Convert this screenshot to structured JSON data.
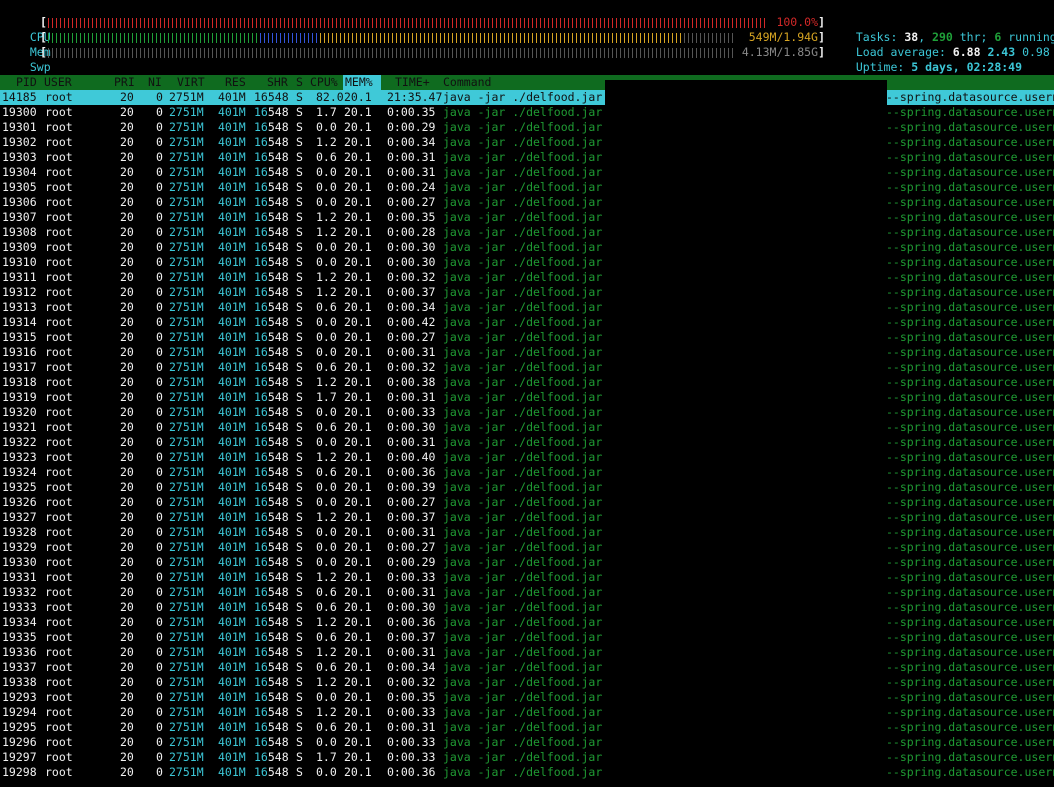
{
  "meters": {
    "cpu": {
      "label": "CPU",
      "value": "100.0%",
      "fraction": 1.0,
      "color": "#d22828"
    },
    "mem": {
      "label": "Mem",
      "value": "549M/1.94G",
      "fraction": 0.93,
      "segments": [
        {
          "fraction": 0.31,
          "color": "#1fa039"
        },
        {
          "fraction": 0.09,
          "color": "#3355dd"
        },
        {
          "fraction": 0.53,
          "color": "#d6a422"
        }
      ]
    },
    "swp": {
      "label": "Swp",
      "value": "4.13M/1.85G",
      "fraction": 0.002,
      "color": "#d22828"
    }
  },
  "stats": {
    "tasks_label": "Tasks: ",
    "tasks": "38",
    "thr_sep": ", ",
    "thr": "290",
    "thr_label": " thr; ",
    "running": "6",
    "running_label": " running",
    "load_label": "Load average: ",
    "load1": "6.88",
    "load5": "2.43",
    "load15": "0.98",
    "uptime_label": "Uptime: ",
    "uptime": "5 days, 02:28:49"
  },
  "columns": [
    "PID",
    "USER",
    "PRI",
    "NI",
    "VIRT",
    "RES",
    "SHR",
    "S",
    "CPU%",
    "MEM%",
    "TIME+",
    "Command"
  ],
  "sort_column": "MEM%",
  "command_prefix": "java -jar ./delfood.jar",
  "command_suffix": "--spring.datasource.usern",
  "rows": [
    {
      "pid": "14185",
      "user": "root",
      "pri": "20",
      "ni": "0",
      "virt": "2751M",
      "res": "401M",
      "shr": "16548",
      "s": "S",
      "cpu": "82.0",
      "mem": "20.1",
      "time": "21:35.47",
      "selected": true
    },
    {
      "pid": "19300",
      "user": "root",
      "pri": "20",
      "ni": "0",
      "virt": "2751M",
      "res": "401M",
      "shr": "16548",
      "s": "S",
      "cpu": "1.7",
      "mem": "20.1",
      "time": "0:00.35"
    },
    {
      "pid": "19301",
      "user": "root",
      "pri": "20",
      "ni": "0",
      "virt": "2751M",
      "res": "401M",
      "shr": "16548",
      "s": "S",
      "cpu": "0.0",
      "mem": "20.1",
      "time": "0:00.29"
    },
    {
      "pid": "19302",
      "user": "root",
      "pri": "20",
      "ni": "0",
      "virt": "2751M",
      "res": "401M",
      "shr": "16548",
      "s": "S",
      "cpu": "1.2",
      "mem": "20.1",
      "time": "0:00.34"
    },
    {
      "pid": "19303",
      "user": "root",
      "pri": "20",
      "ni": "0",
      "virt": "2751M",
      "res": "401M",
      "shr": "16548",
      "s": "S",
      "cpu": "0.6",
      "mem": "20.1",
      "time": "0:00.31"
    },
    {
      "pid": "19304",
      "user": "root",
      "pri": "20",
      "ni": "0",
      "virt": "2751M",
      "res": "401M",
      "shr": "16548",
      "s": "S",
      "cpu": "0.0",
      "mem": "20.1",
      "time": "0:00.31"
    },
    {
      "pid": "19305",
      "user": "root",
      "pri": "20",
      "ni": "0",
      "virt": "2751M",
      "res": "401M",
      "shr": "16548",
      "s": "S",
      "cpu": "0.0",
      "mem": "20.1",
      "time": "0:00.24"
    },
    {
      "pid": "19306",
      "user": "root",
      "pri": "20",
      "ni": "0",
      "virt": "2751M",
      "res": "401M",
      "shr": "16548",
      "s": "S",
      "cpu": "0.0",
      "mem": "20.1",
      "time": "0:00.27"
    },
    {
      "pid": "19307",
      "user": "root",
      "pri": "20",
      "ni": "0",
      "virt": "2751M",
      "res": "401M",
      "shr": "16548",
      "s": "S",
      "cpu": "1.2",
      "mem": "20.1",
      "time": "0:00.35"
    },
    {
      "pid": "19308",
      "user": "root",
      "pri": "20",
      "ni": "0",
      "virt": "2751M",
      "res": "401M",
      "shr": "16548",
      "s": "S",
      "cpu": "1.2",
      "mem": "20.1",
      "time": "0:00.28"
    },
    {
      "pid": "19309",
      "user": "root",
      "pri": "20",
      "ni": "0",
      "virt": "2751M",
      "res": "401M",
      "shr": "16548",
      "s": "S",
      "cpu": "0.0",
      "mem": "20.1",
      "time": "0:00.30"
    },
    {
      "pid": "19310",
      "user": "root",
      "pri": "20",
      "ni": "0",
      "virt": "2751M",
      "res": "401M",
      "shr": "16548",
      "s": "S",
      "cpu": "0.0",
      "mem": "20.1",
      "time": "0:00.30"
    },
    {
      "pid": "19311",
      "user": "root",
      "pri": "20",
      "ni": "0",
      "virt": "2751M",
      "res": "401M",
      "shr": "16548",
      "s": "S",
      "cpu": "1.2",
      "mem": "20.1",
      "time": "0:00.32"
    },
    {
      "pid": "19312",
      "user": "root",
      "pri": "20",
      "ni": "0",
      "virt": "2751M",
      "res": "401M",
      "shr": "16548",
      "s": "S",
      "cpu": "1.2",
      "mem": "20.1",
      "time": "0:00.37"
    },
    {
      "pid": "19313",
      "user": "root",
      "pri": "20",
      "ni": "0",
      "virt": "2751M",
      "res": "401M",
      "shr": "16548",
      "s": "S",
      "cpu": "0.6",
      "mem": "20.1",
      "time": "0:00.34"
    },
    {
      "pid": "19314",
      "user": "root",
      "pri": "20",
      "ni": "0",
      "virt": "2751M",
      "res": "401M",
      "shr": "16548",
      "s": "S",
      "cpu": "0.0",
      "mem": "20.1",
      "time": "0:00.42"
    },
    {
      "pid": "19315",
      "user": "root",
      "pri": "20",
      "ni": "0",
      "virt": "2751M",
      "res": "401M",
      "shr": "16548",
      "s": "S",
      "cpu": "0.0",
      "mem": "20.1",
      "time": "0:00.27"
    },
    {
      "pid": "19316",
      "user": "root",
      "pri": "20",
      "ni": "0",
      "virt": "2751M",
      "res": "401M",
      "shr": "16548",
      "s": "S",
      "cpu": "0.0",
      "mem": "20.1",
      "time": "0:00.31"
    },
    {
      "pid": "19317",
      "user": "root",
      "pri": "20",
      "ni": "0",
      "virt": "2751M",
      "res": "401M",
      "shr": "16548",
      "s": "S",
      "cpu": "0.6",
      "mem": "20.1",
      "time": "0:00.32"
    },
    {
      "pid": "19318",
      "user": "root",
      "pri": "20",
      "ni": "0",
      "virt": "2751M",
      "res": "401M",
      "shr": "16548",
      "s": "S",
      "cpu": "1.2",
      "mem": "20.1",
      "time": "0:00.38"
    },
    {
      "pid": "19319",
      "user": "root",
      "pri": "20",
      "ni": "0",
      "virt": "2751M",
      "res": "401M",
      "shr": "16548",
      "s": "S",
      "cpu": "1.7",
      "mem": "20.1",
      "time": "0:00.31"
    },
    {
      "pid": "19320",
      "user": "root",
      "pri": "20",
      "ni": "0",
      "virt": "2751M",
      "res": "401M",
      "shr": "16548",
      "s": "S",
      "cpu": "0.0",
      "mem": "20.1",
      "time": "0:00.33"
    },
    {
      "pid": "19321",
      "user": "root",
      "pri": "20",
      "ni": "0",
      "virt": "2751M",
      "res": "401M",
      "shr": "16548",
      "s": "S",
      "cpu": "0.6",
      "mem": "20.1",
      "time": "0:00.30"
    },
    {
      "pid": "19322",
      "user": "root",
      "pri": "20",
      "ni": "0",
      "virt": "2751M",
      "res": "401M",
      "shr": "16548",
      "s": "S",
      "cpu": "0.0",
      "mem": "20.1",
      "time": "0:00.31"
    },
    {
      "pid": "19323",
      "user": "root",
      "pri": "20",
      "ni": "0",
      "virt": "2751M",
      "res": "401M",
      "shr": "16548",
      "s": "S",
      "cpu": "1.2",
      "mem": "20.1",
      "time": "0:00.40"
    },
    {
      "pid": "19324",
      "user": "root",
      "pri": "20",
      "ni": "0",
      "virt": "2751M",
      "res": "401M",
      "shr": "16548",
      "s": "S",
      "cpu": "0.6",
      "mem": "20.1",
      "time": "0:00.36"
    },
    {
      "pid": "19325",
      "user": "root",
      "pri": "20",
      "ni": "0",
      "virt": "2751M",
      "res": "401M",
      "shr": "16548",
      "s": "S",
      "cpu": "0.0",
      "mem": "20.1",
      "time": "0:00.39"
    },
    {
      "pid": "19326",
      "user": "root",
      "pri": "20",
      "ni": "0",
      "virt": "2751M",
      "res": "401M",
      "shr": "16548",
      "s": "S",
      "cpu": "0.0",
      "mem": "20.1",
      "time": "0:00.27"
    },
    {
      "pid": "19327",
      "user": "root",
      "pri": "20",
      "ni": "0",
      "virt": "2751M",
      "res": "401M",
      "shr": "16548",
      "s": "S",
      "cpu": "1.2",
      "mem": "20.1",
      "time": "0:00.37"
    },
    {
      "pid": "19328",
      "user": "root",
      "pri": "20",
      "ni": "0",
      "virt": "2751M",
      "res": "401M",
      "shr": "16548",
      "s": "S",
      "cpu": "0.0",
      "mem": "20.1",
      "time": "0:00.31"
    },
    {
      "pid": "19329",
      "user": "root",
      "pri": "20",
      "ni": "0",
      "virt": "2751M",
      "res": "401M",
      "shr": "16548",
      "s": "S",
      "cpu": "0.0",
      "mem": "20.1",
      "time": "0:00.27"
    },
    {
      "pid": "19330",
      "user": "root",
      "pri": "20",
      "ni": "0",
      "virt": "2751M",
      "res": "401M",
      "shr": "16548",
      "s": "S",
      "cpu": "0.0",
      "mem": "20.1",
      "time": "0:00.29"
    },
    {
      "pid": "19331",
      "user": "root",
      "pri": "20",
      "ni": "0",
      "virt": "2751M",
      "res": "401M",
      "shr": "16548",
      "s": "S",
      "cpu": "1.2",
      "mem": "20.1",
      "time": "0:00.33"
    },
    {
      "pid": "19332",
      "user": "root",
      "pri": "20",
      "ni": "0",
      "virt": "2751M",
      "res": "401M",
      "shr": "16548",
      "s": "S",
      "cpu": "0.6",
      "mem": "20.1",
      "time": "0:00.31"
    },
    {
      "pid": "19333",
      "user": "root",
      "pri": "20",
      "ni": "0",
      "virt": "2751M",
      "res": "401M",
      "shr": "16548",
      "s": "S",
      "cpu": "0.6",
      "mem": "20.1",
      "time": "0:00.30"
    },
    {
      "pid": "19334",
      "user": "root",
      "pri": "20",
      "ni": "0",
      "virt": "2751M",
      "res": "401M",
      "shr": "16548",
      "s": "S",
      "cpu": "1.2",
      "mem": "20.1",
      "time": "0:00.36"
    },
    {
      "pid": "19335",
      "user": "root",
      "pri": "20",
      "ni": "0",
      "virt": "2751M",
      "res": "401M",
      "shr": "16548",
      "s": "S",
      "cpu": "0.6",
      "mem": "20.1",
      "time": "0:00.37"
    },
    {
      "pid": "19336",
      "user": "root",
      "pri": "20",
      "ni": "0",
      "virt": "2751M",
      "res": "401M",
      "shr": "16548",
      "s": "S",
      "cpu": "1.2",
      "mem": "20.1",
      "time": "0:00.31"
    },
    {
      "pid": "19337",
      "user": "root",
      "pri": "20",
      "ni": "0",
      "virt": "2751M",
      "res": "401M",
      "shr": "16548",
      "s": "S",
      "cpu": "0.6",
      "mem": "20.1",
      "time": "0:00.34"
    },
    {
      "pid": "19338",
      "user": "root",
      "pri": "20",
      "ni": "0",
      "virt": "2751M",
      "res": "401M",
      "shr": "16548",
      "s": "S",
      "cpu": "1.2",
      "mem": "20.1",
      "time": "0:00.32"
    },
    {
      "pid": "19293",
      "user": "root",
      "pri": "20",
      "ni": "0",
      "virt": "2751M",
      "res": "401M",
      "shr": "16548",
      "s": "S",
      "cpu": "0.0",
      "mem": "20.1",
      "time": "0:00.35"
    },
    {
      "pid": "19294",
      "user": "root",
      "pri": "20",
      "ni": "0",
      "virt": "2751M",
      "res": "401M",
      "shr": "16548",
      "s": "S",
      "cpu": "1.2",
      "mem": "20.1",
      "time": "0:00.33"
    },
    {
      "pid": "19295",
      "user": "root",
      "pri": "20",
      "ni": "0",
      "virt": "2751M",
      "res": "401M",
      "shr": "16548",
      "s": "S",
      "cpu": "0.6",
      "mem": "20.1",
      "time": "0:00.31"
    },
    {
      "pid": "19296",
      "user": "root",
      "pri": "20",
      "ni": "0",
      "virt": "2751M",
      "res": "401M",
      "shr": "16548",
      "s": "S",
      "cpu": "0.0",
      "mem": "20.1",
      "time": "0:00.33"
    },
    {
      "pid": "19297",
      "user": "root",
      "pri": "20",
      "ni": "0",
      "virt": "2751M",
      "res": "401M",
      "shr": "16548",
      "s": "S",
      "cpu": "1.7",
      "mem": "20.1",
      "time": "0:00.33"
    },
    {
      "pid": "19298",
      "user": "root",
      "pri": "20",
      "ni": "0",
      "virt": "2751M",
      "res": "401M",
      "shr": "16548",
      "s": "S",
      "cpu": "0.0",
      "mem": "20.1",
      "time": "0:00.36"
    }
  ]
}
